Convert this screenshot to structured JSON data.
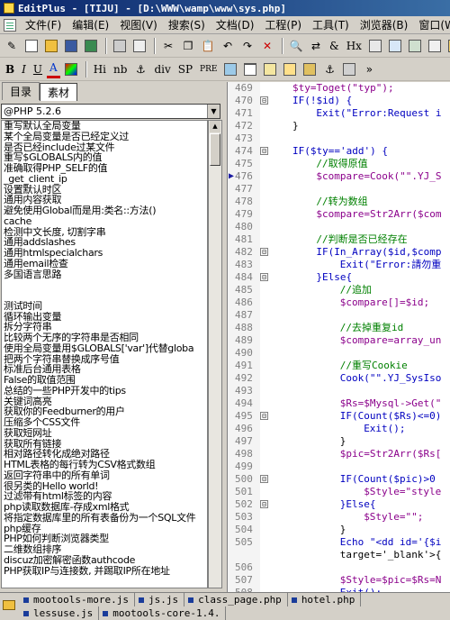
{
  "window": {
    "title": "EditPlus - [TIJU] - [D:\\WWW\\wamp\\www\\sys.php]"
  },
  "menu": [
    "文件(F)",
    "编辑(E)",
    "视图(V)",
    "搜索(S)",
    "文档(D)",
    "工程(P)",
    "工具(T)",
    "浏览器(B)",
    "窗口(W)"
  ],
  "toolbar_html": [
    "B",
    "I",
    "U",
    "A",
    "Hi",
    "nb",
    "div",
    "SP",
    "PRE"
  ],
  "left_panel": {
    "tabs": [
      "目录",
      "素材"
    ],
    "active_tab": "素材",
    "combo_value": "@PHP 5.2.6",
    "items": [
      "重写默认全局变量",
      "某个全局变量是否已经定义过",
      "是否已经include过某文件",
      "重写$GLOBALS内的值",
      "准确取得PHP_SELF的值",
      "_get_client_ip",
      "设置默认时区",
      "通用内容获取",
      "避免使用Global而是用:类名::方法()",
      "cache",
      "检测中文长度, 切割字串",
      "通用addslashes",
      "通用htmlspecialchars",
      "通用email检查",
      "多国语言思路",
      "",
      "",
      "测试时间",
      "循环输出变量",
      "拆分字符串",
      "比较两个无序的字符串是否相同",
      "使用全局变量用$GLOBALS['var']代替globa",
      "把两个字符串替换成序号值",
      "标准后台通用表格",
      "False的取值范围",
      "总结的一些PHP开发中的tips",
      "关键词高亮",
      "获取你的Feedburner的用户",
      "压缩多个CSS文件",
      "获取短网址",
      "获取所有链接",
      "相对路径转化成绝对路径",
      "HTML表格的每行转为CSV格式数组",
      "返回字符串中的所有单词",
      "很另类的Hello world!",
      "过滤带有html标签的内容",
      "php读取数据库-存成xml格式",
      "将指定数据库里的所有表备份为一个SQL文件",
      "php缓存",
      "PHP如何判断浏览器类型",
      "二维数组排序",
      "discuz加密解密函数authcode",
      "PHP获取IP与连接数, 并踢取IP所在地址"
    ]
  },
  "editor": {
    "lines": [
      {
        "n": "469",
        "fold": "",
        "indent": 0,
        "t": "$ty=Toget(\"typ\");"
      },
      {
        "n": "470",
        "fold": "⊟",
        "indent": 0,
        "t": "IF(!$id) {"
      },
      {
        "n": "471",
        "fold": "",
        "indent": 4,
        "t": "Exit(\"Error:Request i"
      },
      {
        "n": "472",
        "fold": "",
        "indent": 0,
        "t": "}"
      },
      {
        "n": "473",
        "fold": "",
        "indent": 0,
        "t": ""
      },
      {
        "n": "474",
        "fold": "⊟",
        "indent": 0,
        "t": "IF($ty=='add') {"
      },
      {
        "n": "475",
        "fold": "",
        "indent": 4,
        "t": "//取得原值"
      },
      {
        "n": "476",
        "fold": "",
        "indent": 4,
        "t": "$compare=Cook(\"\".YJ_S"
      },
      {
        "n": "477",
        "fold": "",
        "indent": 0,
        "t": ""
      },
      {
        "n": "478",
        "fold": "",
        "indent": 4,
        "t": "//转为数组"
      },
      {
        "n": "479",
        "fold": "",
        "indent": 4,
        "t": "$compare=Str2Arr($com"
      },
      {
        "n": "480",
        "fold": "",
        "indent": 0,
        "t": ""
      },
      {
        "n": "481",
        "fold": "",
        "indent": 4,
        "t": "//判断是否已经存在"
      },
      {
        "n": "482",
        "fold": "⊟",
        "indent": 4,
        "t": "IF(In_Array($id,$comp"
      },
      {
        "n": "483",
        "fold": "",
        "indent": 8,
        "t": "Exit(\"Error:請勿重"
      },
      {
        "n": "484",
        "fold": "⊟",
        "indent": 4,
        "t": "}Else{"
      },
      {
        "n": "485",
        "fold": "",
        "indent": 8,
        "t": "//追加"
      },
      {
        "n": "486",
        "fold": "",
        "indent": 8,
        "t": "$compare[]=$id;"
      },
      {
        "n": "487",
        "fold": "",
        "indent": 0,
        "t": ""
      },
      {
        "n": "488",
        "fold": "",
        "indent": 8,
        "t": "//去掉重复id"
      },
      {
        "n": "489",
        "fold": "",
        "indent": 8,
        "t": "$compare=array_un"
      },
      {
        "n": "490",
        "fold": "",
        "indent": 0,
        "t": ""
      },
      {
        "n": "491",
        "fold": "",
        "indent": 8,
        "t": "//重写Cookie"
      },
      {
        "n": "492",
        "fold": "",
        "indent": 8,
        "t": "Cook(\"\".YJ_SysIso"
      },
      {
        "n": "493",
        "fold": "",
        "indent": 0,
        "t": ""
      },
      {
        "n": "494",
        "fold": "",
        "indent": 8,
        "t": "$Rs=$Mysql->Get(\""
      },
      {
        "n": "495",
        "fold": "⊟",
        "indent": 8,
        "t": "IF(Count($Rs)<=0)"
      },
      {
        "n": "496",
        "fold": "",
        "indent": 12,
        "t": "Exit();"
      },
      {
        "n": "497",
        "fold": "",
        "indent": 8,
        "t": "}"
      },
      {
        "n": "498",
        "fold": "",
        "indent": 8,
        "t": "$pic=Str2Arr($Rs["
      },
      {
        "n": "499",
        "fold": "",
        "indent": 0,
        "t": ""
      },
      {
        "n": "500",
        "fold": "⊟",
        "indent": 8,
        "t": "IF(Count($pic)>0"
      },
      {
        "n": "501",
        "fold": "",
        "indent": 12,
        "t": "$Style=\"style"
      },
      {
        "n": "502",
        "fold": "⊟",
        "indent": 8,
        "t": "}Else{"
      },
      {
        "n": "503",
        "fold": "",
        "indent": 12,
        "t": "$Style=\"\";"
      },
      {
        "n": "504",
        "fold": "",
        "indent": 8,
        "t": "}"
      },
      {
        "n": "505",
        "fold": "",
        "indent": 8,
        "t": "Echo \"<dd id='{$i"
      },
      {
        "n": "",
        "fold": "",
        "indent": 8,
        "t": "target='_blank'>{"
      },
      {
        "n": "506",
        "fold": "",
        "indent": 0,
        "t": ""
      },
      {
        "n": "507",
        "fold": "",
        "indent": 8,
        "t": "$Style=$pic=$Rs=N"
      },
      {
        "n": "508",
        "fold": "",
        "indent": 8,
        "t": "Exit();"
      },
      {
        "n": "509",
        "fold": "",
        "indent": 4,
        "t": "}"
      },
      {
        "n": "510",
        "fold": "⊟",
        "indent": 0,
        "t": "}Else{"
      },
      {
        "n": "511",
        "fold": "",
        "indent": 4,
        "t": "//取得原值"
      }
    ]
  },
  "file_tabs": {
    "row1": [
      "mootools-more.js",
      "js.js",
      "class_page.php",
      "hotel.php"
    ],
    "row2": [
      "lessuse.js",
      "mootools-core-1.4."
    ]
  }
}
